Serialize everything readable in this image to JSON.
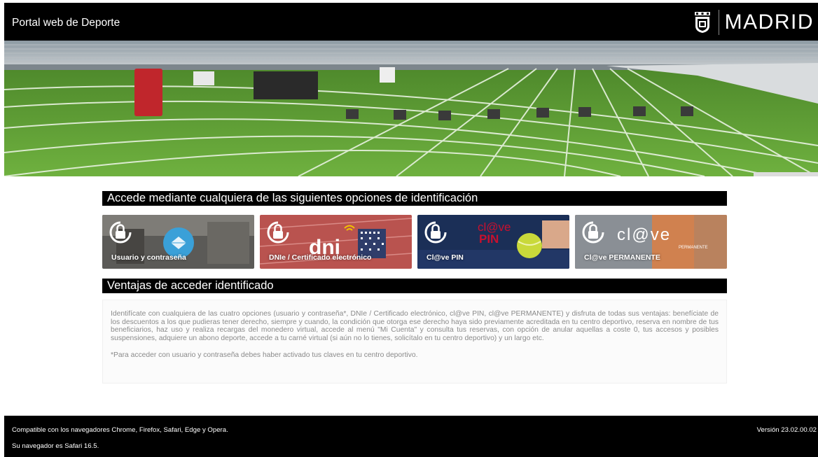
{
  "header": {
    "title": "Portal web de Deporte",
    "brand": "MADRID",
    "crest_icon": "madrid-crest-icon"
  },
  "hero": {
    "image": "athletics-track-stadium"
  },
  "login": {
    "heading": "Accede mediante cualquiera de las siguientes opciones de identificación",
    "options": [
      {
        "label": "Usuario y contraseña",
        "icon": "lock-icon",
        "accent": "#3aa0d8"
      },
      {
        "label": "DNIe / Certificado electrónico",
        "icon": "lock-icon",
        "logo": "dni",
        "accent": "#c05050"
      },
      {
        "label": "Cl@ve PIN",
        "icon": "lock-icon",
        "logo_line1": "cl@ve",
        "logo_line2": "PIN",
        "accent": "#c8102e"
      },
      {
        "label": "Cl@ve PERMANENTE",
        "icon": "lock-icon",
        "logo": "cl@ve",
        "logo_sub": "PERMANENTE",
        "accent": "#e2612a"
      }
    ]
  },
  "benefits": {
    "heading": "Ventajas de acceder identificado",
    "text": "Identifícate con cualquiera de las cuatro opciones (usuario y contraseña*, DNIe / Certificado electrónico, cl@ve PIN, cl@ve PERMANENTE)  y disfruta de todas sus ventajas: benefíciate de los descuentos a los que pudieras tener derecho, siempre y cuando, la condición que otorga ese derecho haya sido previamente acreditada en tu centro deportivo, reserva en nombre de tus beneficiarios, haz uso y realiza recargas del monedero virtual, accede al menú \"Mi Cuenta\" y consulta tus reservas, con opción de anular aquellas a coste 0, tus accesos y posibles suspensiones, adquiere un abono deporte, accede a tu carné virtual (si aún no lo tienes, solicítalo en tu centro deportivo) y un largo etc.",
    "note": "*Para acceder con usuario y contraseña debes haber activado tus claves en tu centro deportivo."
  },
  "footer": {
    "compat": "Compatible con los navegadores Chrome, Firefox, Safari, Edge y Opera.",
    "browser": "Su navegador es Safari 16.5.",
    "version": "Versión 23.02.00.02"
  }
}
